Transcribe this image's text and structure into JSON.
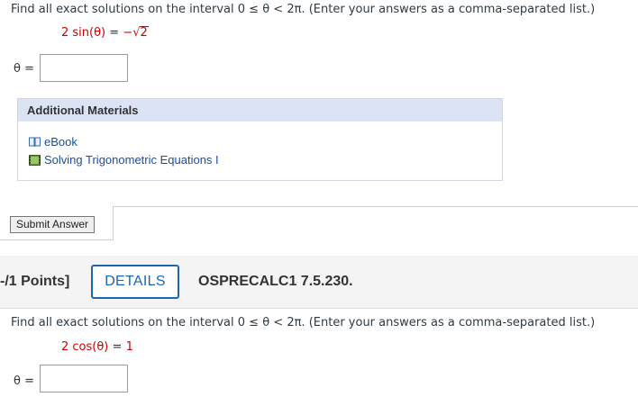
{
  "question1": {
    "prompt_prefix": "Find all exact solutions on the interval",
    "interval": "0 ≤ θ < 2π.",
    "prompt_suffix": "(Enter your answers as a comma-separated list.)",
    "equation_coeff": "2 sin(θ)",
    "equation_equals": "=",
    "equation_minus": "−",
    "equation_radical": "√",
    "equation_radicand": "2",
    "answer_label": "θ =",
    "answer_value": ""
  },
  "additional_materials": {
    "title": "Additional Materials",
    "items": [
      {
        "label": "eBook",
        "icon": "book-icon"
      },
      {
        "label": "Solving Trigonometric Equations I",
        "icon": "video-icon"
      }
    ]
  },
  "submit": {
    "label": "Submit Answer"
  },
  "question2_header": {
    "points": "-/1 Points]",
    "details_label": "DETAILS",
    "question_id": "OSPRECALC1 7.5.230."
  },
  "question2": {
    "prompt_prefix": "Find all exact solutions on the interval",
    "interval": "0 ≤ θ < 2π.",
    "prompt_suffix": "(Enter your answers as a comma-separated list.)",
    "equation_coeff": "2 cos(θ)",
    "equation_equals": "=",
    "equation_rhs": "1",
    "answer_label": "θ =",
    "answer_value": ""
  },
  "colors": {
    "accent": "#1a66b8",
    "equation": "#cc0000",
    "materials_header": "#dce3f5"
  }
}
